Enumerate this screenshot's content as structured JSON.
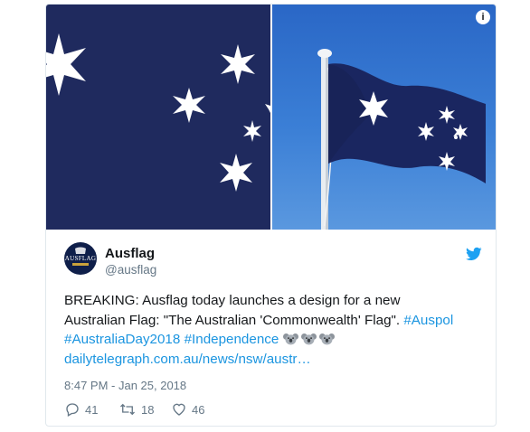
{
  "media": {
    "info_glyph": "i"
  },
  "author": {
    "avatar_text": "AUSFLAG",
    "name": "Ausflag",
    "handle": "@ausflag"
  },
  "tweet": {
    "line1": "BREAKING: Ausflag today launches a design for a new",
    "line2_text": "Australian Flag: \"The Australian 'Commonwealth' Flag\".",
    "hashtag_auspol": "#Auspol",
    "hashtag_australiaday": "#AustraliaDay2018",
    "hashtag_independence": "#Independence",
    "link": "dailytelegraph.com.au/news/nsw/austr…",
    "timestamp": "8:47 PM - Jan 25, 2018"
  },
  "actions": {
    "replies": "41",
    "retweets": "18",
    "likes": "46"
  },
  "colors": {
    "link": "#1b95e0",
    "twitter_blue": "#1da1f2",
    "flag_navy": "#1f2a5e"
  }
}
